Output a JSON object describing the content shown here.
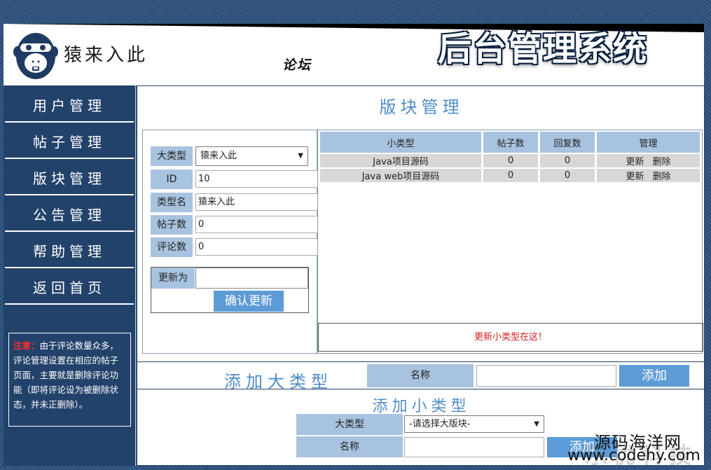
{
  "header": {
    "brand": "猿来入此",
    "forum_title": "论坛",
    "system_title": "后台管理系统"
  },
  "sidebar": {
    "items": [
      {
        "label": "用户管理"
      },
      {
        "label": "帖子管理"
      },
      {
        "label": "版块管理"
      },
      {
        "label": "公告管理"
      },
      {
        "label": "帮助管理"
      },
      {
        "label": "返回首页"
      }
    ],
    "note_label": "注意：",
    "note_text": "由于评论数量众多，评论管理设置在相应的帖子页面，主要就是删除评论功能（即将评论设为被删除状态，并未正删除）。"
  },
  "main": {
    "title": "版块管理",
    "edit_form": {
      "category_label": "大类型",
      "category_value": "猿来入此",
      "id_label": "ID",
      "id_value": "10",
      "type_name_label": "类型名",
      "type_name_value": "猿来入此",
      "posts_label": "帖子数",
      "posts_value": "0",
      "comments_label": "评论数",
      "comments_value": "0",
      "update_label": "更新为",
      "confirm_button": "确认更新"
    },
    "sub_table": {
      "headers": [
        "小类型",
        "帖子数",
        "回复数",
        "管理"
      ],
      "rows": [
        {
          "name": "Java项目源码",
          "posts": "0",
          "replies": "0",
          "update": "更新",
          "delete": "删除"
        },
        {
          "name": "Java web项目源码",
          "posts": "0",
          "replies": "0",
          "update": "更新",
          "delete": "删除"
        }
      ],
      "hint": "更新小类型在这！"
    },
    "add_big": {
      "title": "添加大类型",
      "name_label": "名称",
      "button": "添加"
    },
    "add_small": {
      "title": "添加小类型",
      "type_label": "大类型",
      "select_value": "-请选择大版块-",
      "name_label": "名称",
      "button": "添加"
    }
  },
  "watermark": {
    "chinese": "源码海洋网",
    "url": "www.codehy.com",
    "faded_text": "乐优科技"
  },
  "colors": {
    "nav_bg": "#23426b",
    "accent_blue": "#4f8dc8",
    "label_bg": "#a8c3e0",
    "button_bg": "#5d9bd6",
    "hint_red": "#d62020"
  }
}
